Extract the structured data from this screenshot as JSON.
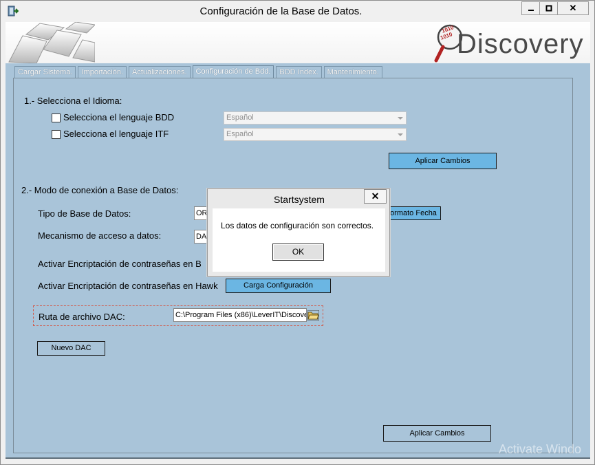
{
  "window": {
    "title": "Configuración de la Base de Datos.",
    "minimize_icon": "minimize-icon",
    "maximize_icon": "maximize-icon",
    "close_label": "✕"
  },
  "banner": {
    "logo_text": "Discovery",
    "binary_top": "1010",
    "binary_bottom": "1010"
  },
  "tabs": [
    {
      "label": "Cargar Sistema."
    },
    {
      "label": "Importación."
    },
    {
      "label": "Actualizaciones."
    },
    {
      "label": "Configuración de Bdd."
    },
    {
      "label": "BDD Index."
    },
    {
      "label": "Mantenimiento."
    }
  ],
  "section1": {
    "heading": "1.- Selecciona el Idioma:",
    "bdd_label": "Selecciona el lenguaje BDD",
    "bdd_value": "Español",
    "itf_label": "Selecciona el lenguaje ITF",
    "itf_value": "Español",
    "apply_label": "Aplicar Cambios"
  },
  "section2": {
    "heading": "2.- Modo de conexión a Base de Datos:",
    "db_type_label": "Tipo de Base de Datos:",
    "db_type_value": "OR",
    "date_format_label": "ormato Fecha",
    "access_label": "Mecanismo de acceso a datos:",
    "access_value": "DA",
    "encrypt_b_label": "Activar Encriptación de contraseñas en B",
    "encrypt_hawk_label": "Activar Encriptación de contraseñas en Hawk",
    "load_config_label": "Carga Configuración",
    "dac_label": "Ruta de archivo DAC:",
    "dac_value": "C:\\Program Files (x86)\\LeverIT\\Discove",
    "new_dac_label": "Nuevo DAC",
    "apply_bottom_label": "Aplicar Cambios"
  },
  "dialog": {
    "title": "Startsystem",
    "close_label": "✕",
    "message": "Los datos de configuración son correctos.",
    "ok_label": "OK"
  },
  "watermark": "Activate Windo",
  "colors": {
    "panel": "#a9c4d9",
    "button_blue": "#6bb6e3",
    "dashed": "#d15a4a"
  }
}
